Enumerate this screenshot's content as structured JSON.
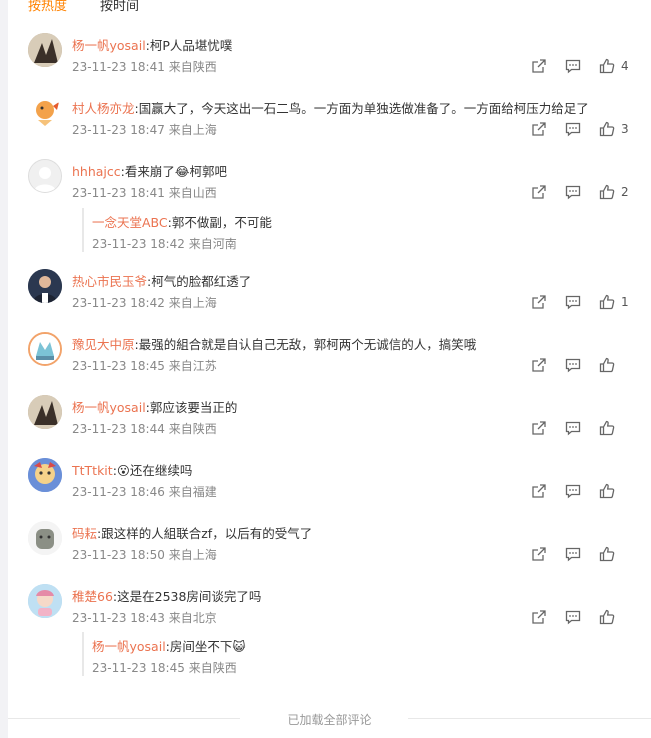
{
  "tabs": {
    "hot": "按热度",
    "time": "按时间"
  },
  "comments": [
    {
      "user": "杨一帆yosail",
      "text": ":柯P人品堪忧噗",
      "time": "23-11-23 18:41",
      "loc": "来自陕西",
      "likes": "4",
      "avatar_color": "#b09a7e"
    },
    {
      "user": "村人杨亦龙",
      "text": ":国赢大了，今天这出一石二鸟。一方面为单独选做准备了。一方面给柯压力给足了",
      "time": "23-11-23 18:47",
      "loc": "来自上海",
      "likes": "3",
      "avatar_color": "#f3a24b"
    },
    {
      "user": "hhhajcc",
      "text": ":看来崩了😂柯郭吧",
      "time": "23-11-23 18:41",
      "loc": "来自山西",
      "likes": "2",
      "avatar_color": "#e6e6e6",
      "reply": {
        "user": "一念天堂ABC",
        "text": ":郭不做副，不可能",
        "time": "23-11-23 18:42",
        "loc": "来自河南"
      }
    },
    {
      "user": "热心市民玉爷",
      "text": ":柯气的脸都红透了",
      "time": "23-11-23 18:42",
      "loc": "来自上海",
      "likes": "1",
      "avatar_color": "#2b3850"
    },
    {
      "user": "豫见大中原",
      "text": ":最强的組合就是自认自己无敌，郭柯两个无诚信的人，搞笑哦",
      "time": "23-11-23 18:45",
      "loc": "来自江苏",
      "likes": "",
      "avatar_color": "#7cc3d6"
    },
    {
      "user": "杨一帆yosail",
      "text": ":郭应该要当正的",
      "time": "23-11-23 18:44",
      "loc": "来自陕西",
      "likes": "",
      "avatar_color": "#b09a7e"
    },
    {
      "user": "TtTtkit",
      "text": ":😮还在继续吗",
      "time": "23-11-23 18:46",
      "loc": "来自福建",
      "likes": "",
      "avatar_color": "#6a8fd8"
    },
    {
      "user": "码耘",
      "text": ":跟这样的人組联合zf，以后有的受气了",
      "time": "23-11-23 18:50",
      "loc": "来自上海",
      "likes": "",
      "avatar_color": "#8b8f85"
    },
    {
      "user": "稚楚66",
      "text": ":这是在2538房间谈完了吗",
      "time": "23-11-23 18:43",
      "loc": "来自北京",
      "likes": "",
      "avatar_color": "#9cc9e8",
      "reply": {
        "user": "杨一帆yosail",
        "text": ":房间坐不下😺",
        "time": "23-11-23 18:45",
        "loc": "来自陕西"
      }
    }
  ],
  "footer": "已加载全部评论"
}
